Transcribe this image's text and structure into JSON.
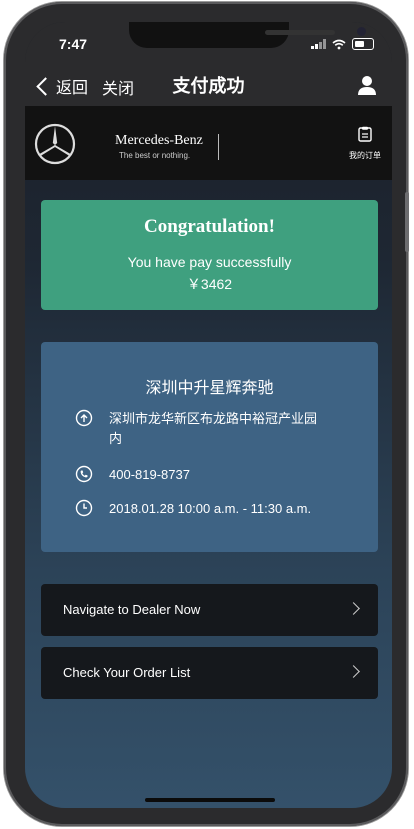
{
  "status_bar": {
    "time": "7:47"
  },
  "nav": {
    "back_label": "返回",
    "close_label": "关闭",
    "title": "支付成功"
  },
  "brand": {
    "name": "Mercedes-Benz",
    "tagline": "The best or nothing.",
    "my_orders_label": "我的订单"
  },
  "success": {
    "heading": "Congratulation!",
    "message": "You have pay successfully",
    "amount": "￥3462"
  },
  "dealer": {
    "name": "深圳中升星辉奔驰",
    "address": "深圳市龙华新区布龙路中裕冠产业园内",
    "phone": "400-819-8737",
    "appointment": "2018.01.28  10:00 a.m. - 11:30 a.m."
  },
  "actions": {
    "navigate_label": "Navigate to Dealer Now",
    "orders_label": "Check Your Order List"
  },
  "colors": {
    "success_green": "#3fa07f",
    "info_blue": "#3e6384",
    "button_dark": "#15181c"
  }
}
